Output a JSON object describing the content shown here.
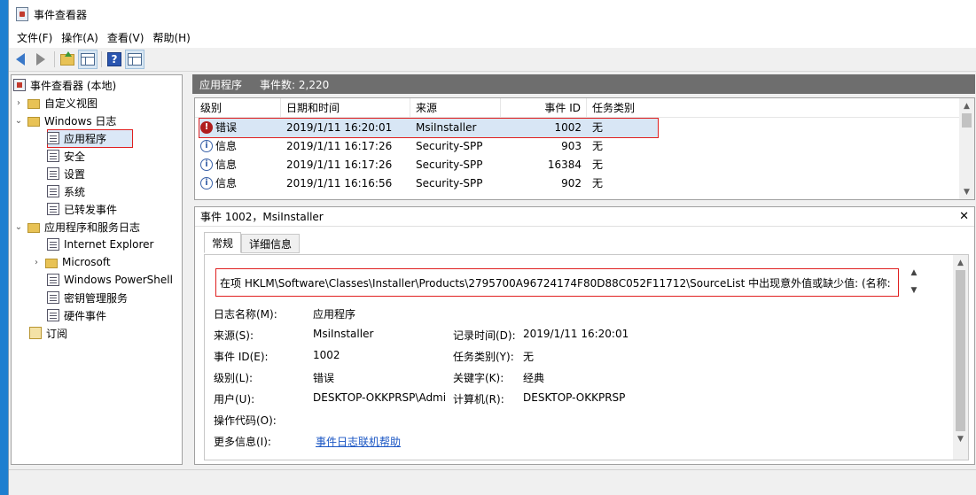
{
  "window": {
    "title": "事件查看器"
  },
  "menu": [
    "文件(F)",
    "操作(A)",
    "查看(V)",
    "帮助(H)"
  ],
  "tree": {
    "root": "事件查看器 (本地)",
    "custom_views": "自定义视图",
    "windows_logs": "Windows 日志",
    "windows_logs_items": [
      "应用程序",
      "安全",
      "设置",
      "系统",
      "已转发事件"
    ],
    "app_service_logs": "应用程序和服务日志",
    "app_service_items": [
      "Internet Explorer",
      "Microsoft",
      "Windows PowerShell",
      "密钥管理服务",
      "硬件事件"
    ],
    "subscriptions": "订阅"
  },
  "header": {
    "log_name": "应用程序",
    "count_label": "事件数: 2,220"
  },
  "columns": [
    "级别",
    "日期和时间",
    "来源",
    "事件 ID",
    "任务类别"
  ],
  "events": [
    {
      "level": "错误",
      "icon": "error-icon",
      "datetime": "2019/1/11 16:20:01",
      "source": "MsiInstaller",
      "id": "1002",
      "category": "无"
    },
    {
      "level": "信息",
      "icon": "info-icon",
      "datetime": "2019/1/11 16:17:26",
      "source": "Security-SPP",
      "id": "903",
      "category": "无"
    },
    {
      "level": "信息",
      "icon": "info-icon",
      "datetime": "2019/1/11 16:17:26",
      "source": "Security-SPP",
      "id": "16384",
      "category": "无"
    },
    {
      "level": "信息",
      "icon": "info-icon",
      "datetime": "2019/1/11 16:16:56",
      "source": "Security-SPP",
      "id": "902",
      "category": "无"
    }
  ],
  "detail": {
    "title": "事件 1002，MsiInstaller",
    "tabs": [
      "常规",
      "详细信息"
    ],
    "description": "在项 HKLM\\Software\\Classes\\Installer\\Products\\2795700A96724174F80D88C052F11712\\SourceList 中出现意外值或缺少值: (名称:",
    "labels": {
      "log_name": "日志名称(M):",
      "source": "来源(S):",
      "event_id": "事件 ID(E):",
      "level": "级别(L):",
      "user": "用户(U):",
      "opcode": "操作代码(O):",
      "more_info": "更多信息(I):",
      "logged": "记录时间(D):",
      "task_category": "任务类别(Y):",
      "keywords": "关键字(K):",
      "computer": "计算机(R):"
    },
    "values": {
      "log_name": "应用程序",
      "source": "MsiInstaller",
      "event_id": "1002",
      "level": "错误",
      "user": "DESKTOP-OKKPRSP\\Admi",
      "opcode": "",
      "more_info_link": "事件日志联机帮助",
      "logged": "2019/1/11 16:20:01",
      "task_category": "无",
      "keywords": "经典",
      "computer": "DESKTOP-OKKPRSP"
    }
  }
}
